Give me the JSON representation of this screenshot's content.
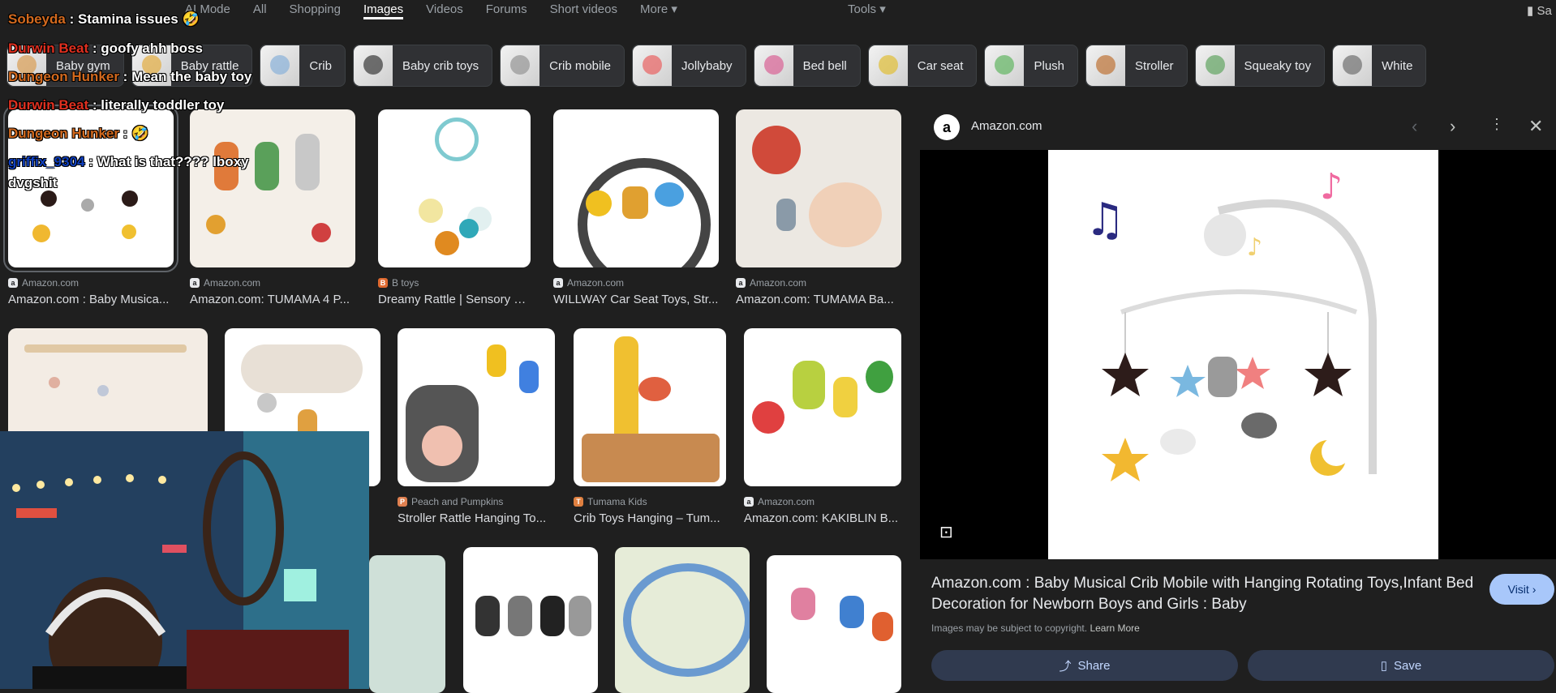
{
  "tabs": [
    {
      "label": "AI Mode"
    },
    {
      "label": "All"
    },
    {
      "label": "Shopping"
    },
    {
      "label": "Images"
    },
    {
      "label": "Videos"
    },
    {
      "label": "Forums"
    },
    {
      "label": "Short videos"
    },
    {
      "label": "More"
    }
  ],
  "tools_label": "Tools",
  "saved_label": "Sa",
  "chips": [
    {
      "label": "Baby gym",
      "color": "#d9a15c"
    },
    {
      "label": "Baby rattle",
      "color": "#e3b04b"
    },
    {
      "label": "Crib",
      "color": "#8fb4d9"
    },
    {
      "label": "Baby crib toys",
      "color": "#444444"
    },
    {
      "label": "Crib mobile",
      "color": "#999999"
    },
    {
      "label": "Jollybaby",
      "color": "#e86a6a"
    },
    {
      "label": "Bed bell",
      "color": "#d96a9a"
    },
    {
      "label": "Car seat",
      "color": "#e0c040"
    },
    {
      "label": "Plush",
      "color": "#6ab86a"
    },
    {
      "label": "Stroller",
      "color": "#c07a40"
    },
    {
      "label": "Squeaky toy",
      "color": "#6aa86a"
    },
    {
      "label": "White",
      "color": "#777777"
    }
  ],
  "results": [
    {
      "source": "Amazon.com",
      "title": "Amazon.com : Baby Musica..."
    },
    {
      "source": "Amazon.com",
      "title": "Amazon.com: TUMAMA 4 P..."
    },
    {
      "source": "B  toys",
      "title": "Dreamy Rattle | Sensory Ba..."
    },
    {
      "source": "Amazon.com",
      "title": "WILLWAY Car Seat Toys, Str..."
    },
    {
      "source": "Amazon.com",
      "title": "Amazon.com: TUMAMA Ba..."
    },
    {
      "source": "Peach and Pumpkins",
      "title": "Stroller Rattle Hanging To..."
    },
    {
      "source": "Tumama Kids",
      "title": "Crib Toys Hanging – Tum..."
    },
    {
      "source": "Amazon.com",
      "title": "Amazon.com: KAKIBLIN B..."
    }
  ],
  "panel": {
    "favicon": "a",
    "source": "Amazon.com",
    "title": "Amazon.com : Baby Musical Crib Mobile with Hanging Rotating Toys,Infant Bed Decoration for Newborn Boys and Girls : Baby",
    "copyright": "Images may be subject to copyright.",
    "learn_more": "Learn More",
    "visit_label": "Visit",
    "share_label": "Share",
    "save_label": "Save"
  },
  "chat": [
    {
      "user": "Sobeyda",
      "sep": " : ",
      "message": "Stamina issues 🤣"
    },
    {
      "user": "Durwin Beat",
      "sep": " : ",
      "message": "goofy ahh boss"
    },
    {
      "user": "Dungeon Hunker",
      "sep": " : ",
      "message": "Mean the baby toy"
    },
    {
      "user": "Durwin Beat",
      "sep": " : ",
      "message": "literally toddler toy"
    },
    {
      "user": "Dungeon Hunker",
      "sep": " : ",
      "message": "🤣"
    },
    {
      "user": "griffix_9304",
      "sep": " : ",
      "message": "What is that???? lboxy"
    },
    {
      "user": "",
      "sep": "",
      "message": "dvgshit"
    }
  ],
  "colors": {
    "background": "#1f1f1f",
    "accent": "#a8c7fa",
    "button": "#303a4f"
  }
}
